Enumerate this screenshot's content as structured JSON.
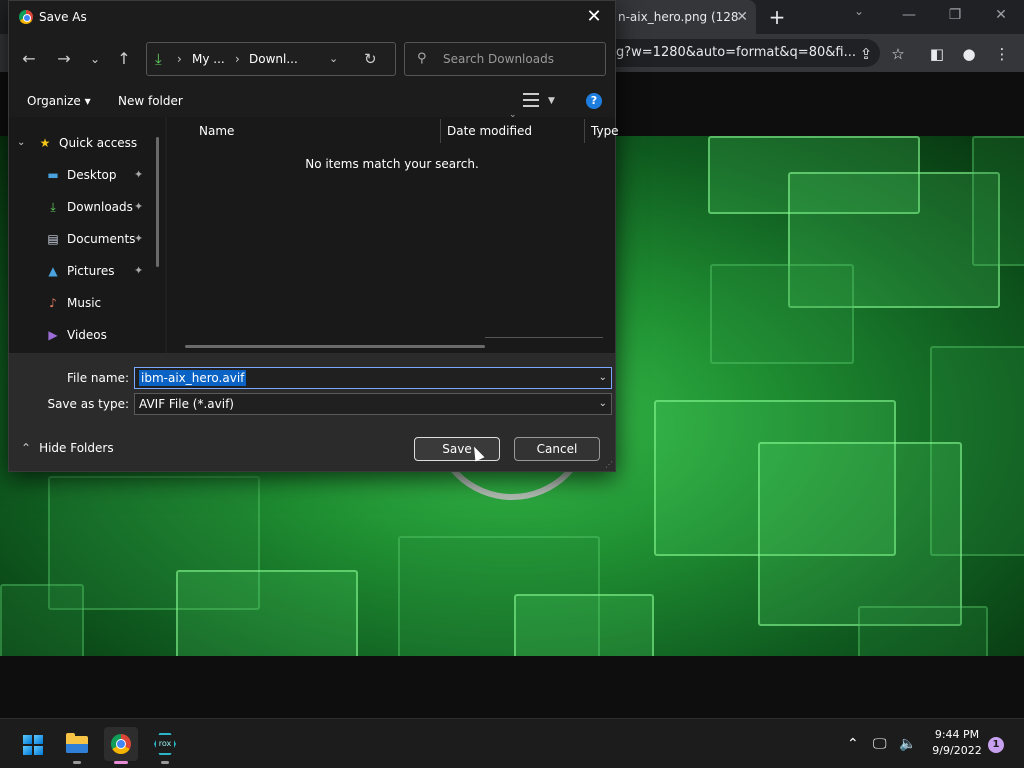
{
  "browser": {
    "tab_title": "n-aix_hero.png (128",
    "tab_close": "✕",
    "new_tab": "+",
    "url": "g?w=1280&auto=format&q=80&fi...",
    "minimize": "—",
    "restore": "❐",
    "close": "✕"
  },
  "dialog": {
    "title": "Save As",
    "close_glyph": "✕",
    "nav": {
      "back": "←",
      "forward": "→",
      "recent": "⌄",
      "up": "↑"
    },
    "breadcrumb": {
      "part1": "My ...",
      "part2": "Downl...",
      "sep": "›"
    },
    "search_placeholder": "Search Downloads",
    "organize": "Organize ▾",
    "new_folder": "New folder",
    "help": "?",
    "sidebar": [
      {
        "label": "Quick access",
        "icon": "star-icon",
        "color": "#f5c518",
        "glyph": "★"
      },
      {
        "label": "Desktop",
        "icon": "desktop-icon",
        "color": "#4aa3df",
        "glyph": "▬",
        "pinned": "📌"
      },
      {
        "label": "Downloads",
        "icon": "download-icon",
        "color": "#5fd35f",
        "glyph": "⤓",
        "pinned": "📌"
      },
      {
        "label": "Documents",
        "icon": "document-icon",
        "color": "#c9d1e0",
        "glyph": "▤",
        "pinned": "📌"
      },
      {
        "label": "Pictures",
        "icon": "pictures-icon",
        "color": "#4aa3df",
        "glyph": "▲",
        "pinned": "📌"
      },
      {
        "label": "Music",
        "icon": "music-icon",
        "color": "#e07a5f",
        "glyph": "♪"
      },
      {
        "label": "Videos",
        "icon": "videos-icon",
        "color": "#9b6dd6",
        "glyph": "▶"
      }
    ],
    "columns": {
      "name": "Name",
      "date": "Date modified",
      "type": "Type"
    },
    "empty_message": "No items match your search.",
    "file_name_label": "File name:",
    "file_name_value": "ibm-aix_hero.avif",
    "save_type_label": "Save as type:",
    "save_type_value": "AVIF File (*.avif)",
    "hide_folders": "Hide Folders",
    "save": "Save",
    "cancel": "Cancel"
  },
  "taskbar": {
    "time": "9:44 PM",
    "date": "9/9/2022",
    "notifications": "1",
    "rox_label": "rox"
  }
}
